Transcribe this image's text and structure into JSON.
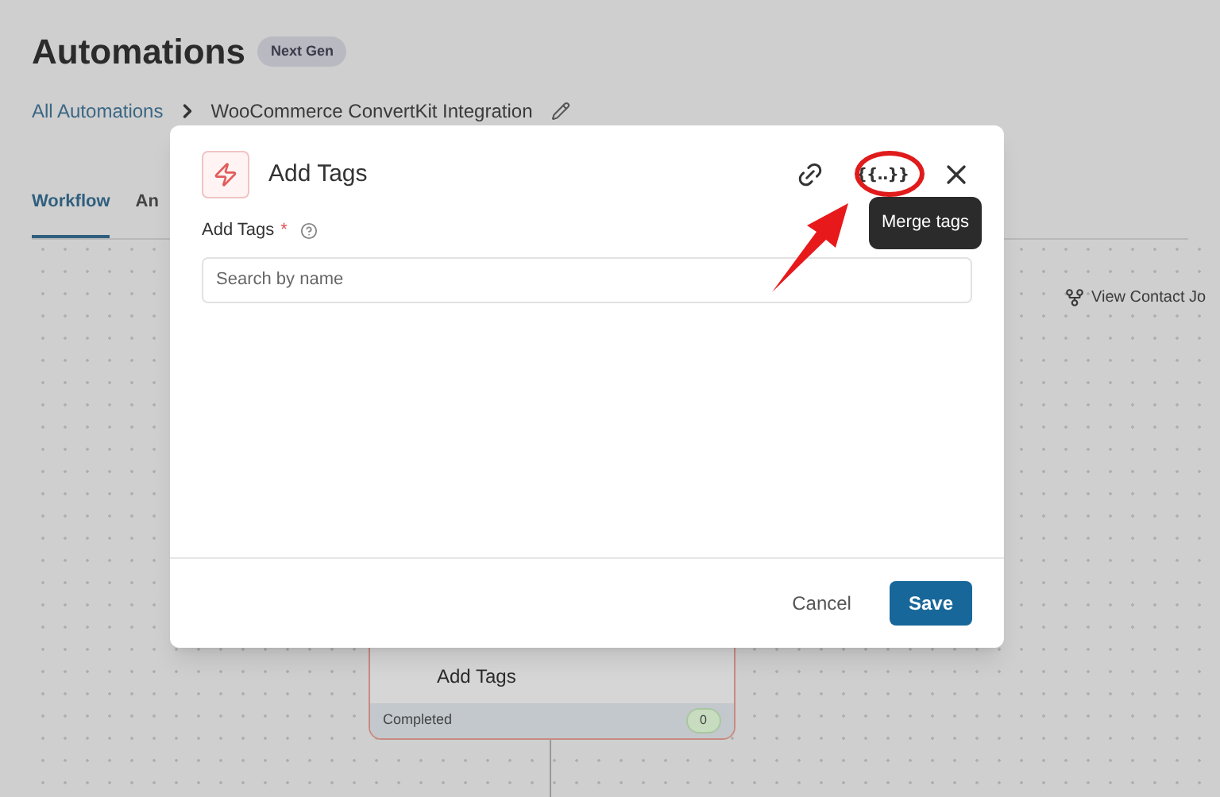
{
  "page": {
    "title": "Automations",
    "badge": "Next Gen"
  },
  "breadcrumb": {
    "link": "All Automations",
    "current": "WooCommerce ConvertKit Integration"
  },
  "tabs": [
    {
      "label": "Workflow",
      "selected": true
    },
    {
      "label": "An",
      "selected": false
    }
  ],
  "canvas": {
    "contact_journey": "View Contact Jo",
    "node": {
      "title": "Add Tags",
      "footer_label": "Completed",
      "count": "0"
    }
  },
  "modal": {
    "title": "Add Tags",
    "field_label": "Add Tags",
    "required_mark": "*",
    "placeholder": "Search by name",
    "tooltip": "Merge tags",
    "merge_tags_icon": "{{..}}",
    "buttons": [
      {
        "label": "Cancel",
        "kind": "secondary"
      },
      {
        "label": "Save",
        "kind": "primary"
      }
    ]
  }
}
